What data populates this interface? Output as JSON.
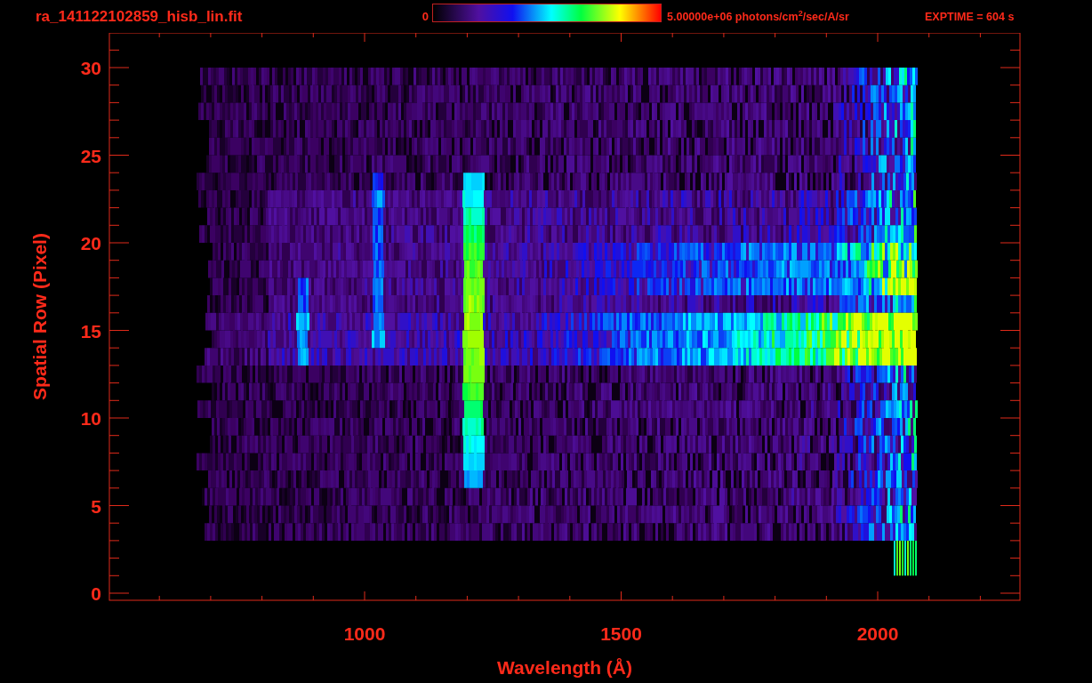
{
  "header": {
    "title": "ra_141122102859_hisb_lin.fit",
    "colorbar": {
      "min_label": "0",
      "max_label": "5.00000e+06 photons/cm$^{2}$/sec/A/sr"
    },
    "exposure": "EXPTIME = 604 s"
  },
  "plot": {
    "x_axis": {
      "label": "Wavelength (Å)",
      "ticks": [
        "1000",
        "1500",
        "2000"
      ]
    },
    "y_axis": {
      "label": "Spatial Row (Pixel)",
      "ticks": [
        "30",
        "25",
        "20",
        "15",
        "10",
        "5",
        "0"
      ]
    }
  }
}
